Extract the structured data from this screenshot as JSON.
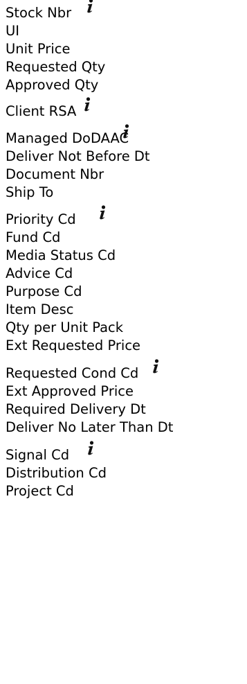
{
  "fields": [
    {
      "label": "Stock Nbr",
      "info": true
    },
    {
      "label": "UI",
      "info": false
    },
    {
      "label": "Unit Price",
      "info": false
    },
    {
      "label": "Requested Qty",
      "info": false
    },
    {
      "label": "Approved Qty",
      "info": false
    },
    {
      "label": "Client RSA",
      "info": true
    },
    {
      "label": "Managed DoDAAC",
      "info": true
    },
    {
      "label": "Deliver Not Before Dt",
      "info": false
    },
    {
      "label": "Document Nbr",
      "info": false
    },
    {
      "label": "Ship To",
      "info": false
    },
    {
      "label": "Priority Cd",
      "info": true
    },
    {
      "label": "Fund Cd",
      "info": false
    },
    {
      "label": "Media Status Cd",
      "info": false
    },
    {
      "label": "Advice Cd",
      "info": false
    },
    {
      "label": "Purpose Cd",
      "info": false
    },
    {
      "label": "Item Desc",
      "info": false
    },
    {
      "label": "Qty per Unit Pack",
      "info": false
    },
    {
      "label": "Ext Requested Price",
      "info": false
    },
    {
      "label": "Requested Cond Cd",
      "info": true
    },
    {
      "label": "Ext Approved Price",
      "info": false
    },
    {
      "label": "Required Delivery Dt",
      "info": false
    },
    {
      "label": "Deliver No Later Than Dt",
      "info": false
    },
    {
      "label": "Signal Cd",
      "info": true
    },
    {
      "label": "Distribution Cd",
      "info": false
    },
    {
      "label": "Project Cd",
      "info": false
    }
  ],
  "info_icon": "info-icon"
}
